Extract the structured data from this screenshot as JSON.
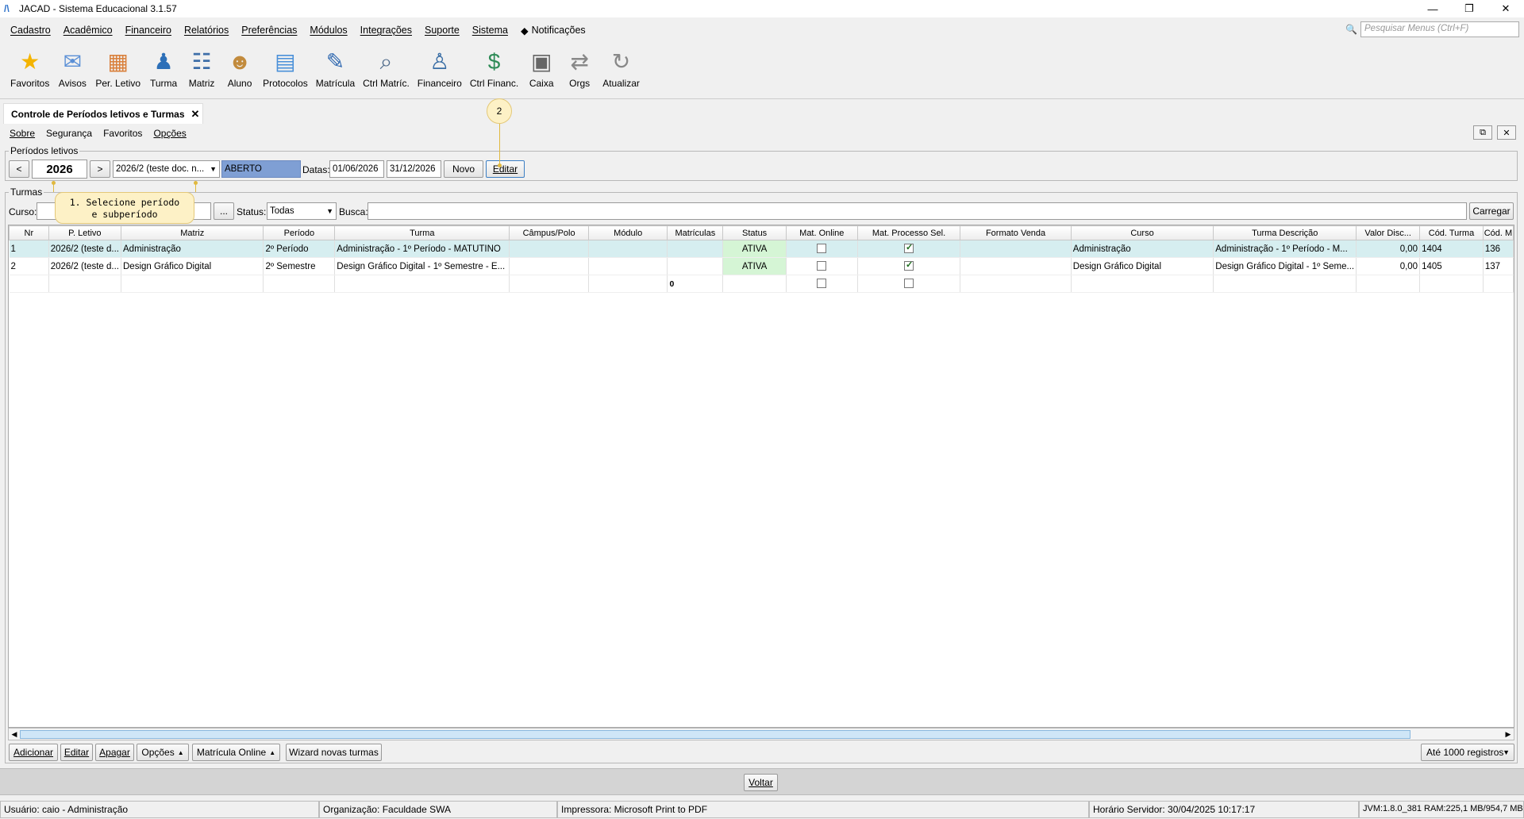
{
  "window": {
    "title": "JACAD - Sistema Educacional 3.1.57",
    "minimize": "—",
    "maximize": "❐",
    "close": "✕"
  },
  "menu": {
    "items": [
      "Cadastro",
      "Acadêmico",
      "Financeiro",
      "Relatórios",
      "Preferências",
      "Módulos",
      "Integrações",
      "Suporte",
      "Sistema"
    ],
    "notifications": "Notificações",
    "search_placeholder": "Pesquisar Menus (Ctrl+F)"
  },
  "toolbar": {
    "items": [
      {
        "label": "Favoritos",
        "icon": "star-icon",
        "glyph": "★",
        "color": "#f4b400"
      },
      {
        "label": "Avisos",
        "icon": "envelope-icon",
        "glyph": "✉",
        "color": "#5a8fd6"
      },
      {
        "label": "Per. Letivo",
        "icon": "calendar-icon",
        "glyph": "▦",
        "color": "#d9803c"
      },
      {
        "label": "Turma",
        "icon": "group-icon",
        "glyph": "♟",
        "color": "#2c6fb8"
      },
      {
        "label": "Matriz",
        "icon": "matrix-icon",
        "glyph": "☷",
        "color": "#3d6ea8"
      },
      {
        "label": "Aluno",
        "icon": "student-icon",
        "glyph": "☻",
        "color": "#c28b3d"
      },
      {
        "label": "Protocolos",
        "icon": "protocol-icon",
        "glyph": "▤",
        "color": "#4a90d9"
      },
      {
        "label": "Matrícula",
        "icon": "enrollment-icon",
        "glyph": "✎",
        "color": "#2f68b0"
      },
      {
        "label": "Ctrl Matríc.",
        "icon": "enrollment-control-icon",
        "glyph": "⌕",
        "color": "#4f6a8a"
      },
      {
        "label": "Financeiro",
        "icon": "finance-icon",
        "glyph": "♙",
        "color": "#3a6ea5"
      },
      {
        "label": "Ctrl Financ.",
        "icon": "finance-control-icon",
        "glyph": "$",
        "color": "#2e8b57"
      },
      {
        "label": "Caixa",
        "icon": "cash-register-icon",
        "glyph": "▣",
        "color": "#666666"
      },
      {
        "label": "Orgs",
        "icon": "arrows-icon",
        "glyph": "⇄",
        "color": "#888888"
      },
      {
        "label": "Atualizar",
        "icon": "refresh-icon",
        "glyph": "↻",
        "color": "#888888"
      }
    ]
  },
  "tab": {
    "title": "Controle de Períodos letivos e Turmas",
    "close": "✕"
  },
  "submenu": {
    "items": [
      "Sobre",
      "Segurança",
      "Favoritos",
      "Opções"
    ]
  },
  "periodos": {
    "group_title": "Períodos letivos",
    "prev": "<",
    "year": "2026",
    "next": ">",
    "subperiod": "2026/2 (teste doc. n...",
    "status": "ABERTO",
    "datas_label": "Datas:",
    "date_start": "01/06/2026",
    "date_end": "31/12/2026",
    "novo": "Novo",
    "editar": "Editar"
  },
  "turmas": {
    "group_title": "Turmas",
    "curso_label": "Curso:",
    "ellipsis": "...",
    "status_label": "Status:",
    "status_value": "Todas",
    "busca_label": "Busca:",
    "carregar": "Carregar"
  },
  "table": {
    "columns": [
      "Nr",
      "P. Letivo",
      "Matriz",
      "Período",
      "Turma",
      "Câmpus/Polo",
      "Módulo",
      "Matrículas",
      "Status",
      "Mat. Online",
      "Mat. Processo Sel.",
      "Formato Venda",
      "Curso",
      "Turma Descrição",
      "Valor Disc...",
      "Cód. Turma",
      "Cód. M"
    ],
    "rows": [
      {
        "nr": "1",
        "pletivo": "2026/2 (teste d...",
        "matriz": "Administração",
        "periodo": "2º Período",
        "turma": "Administração - 1º Período - MATUTINO",
        "campus": "",
        "modulo": "",
        "matriculas": "",
        "status": "ATIVA",
        "online": false,
        "processo": true,
        "formato": "",
        "curso": "Administração",
        "descricao": "Administração - 1º Período - M...",
        "valor": "0,00",
        "cod_turma": "1404",
        "cod_m": "136"
      },
      {
        "nr": "2",
        "pletivo": "2026/2 (teste d...",
        "matriz": "Design Gráfico Digital",
        "periodo": "2º Semestre",
        "turma": "Design Gráfico Digital - 1º Semestre - E...",
        "campus": "",
        "modulo": "",
        "matriculas": "",
        "status": "ATIVA",
        "online": false,
        "processo": true,
        "formato": "",
        "curso": "Design Gráfico Digital",
        "descricao": "Design Gráfico Digital - 1º Seme...",
        "valor": "0,00",
        "cod_turma": "1405",
        "cod_m": "137"
      }
    ],
    "total_matriculas": "0"
  },
  "actions": {
    "adicionar": "Adicionar",
    "editar": "Editar",
    "apagar": "Apagar",
    "opcoes": "Opções",
    "matricula_online": "Matrícula Online",
    "wizard": "Wizard novas turmas",
    "limit": "Até 1000 registros"
  },
  "voltar": "Voltar",
  "status_bar": {
    "usuario": "Usuário: caio - Administração",
    "organizacao": "Organização: Faculdade SWA",
    "impressora": "Impressora: Microsoft Print to PDF",
    "horario": "Horário Servidor: 30/04/2025 10:17:17",
    "jvm": "JVM:1.8.0_381  RAM:225,1 MB/954,7 MB"
  },
  "callouts": {
    "step1_line1": "1. Selecione período",
    "step1_line2": "e subperíodo",
    "step2": "2"
  }
}
